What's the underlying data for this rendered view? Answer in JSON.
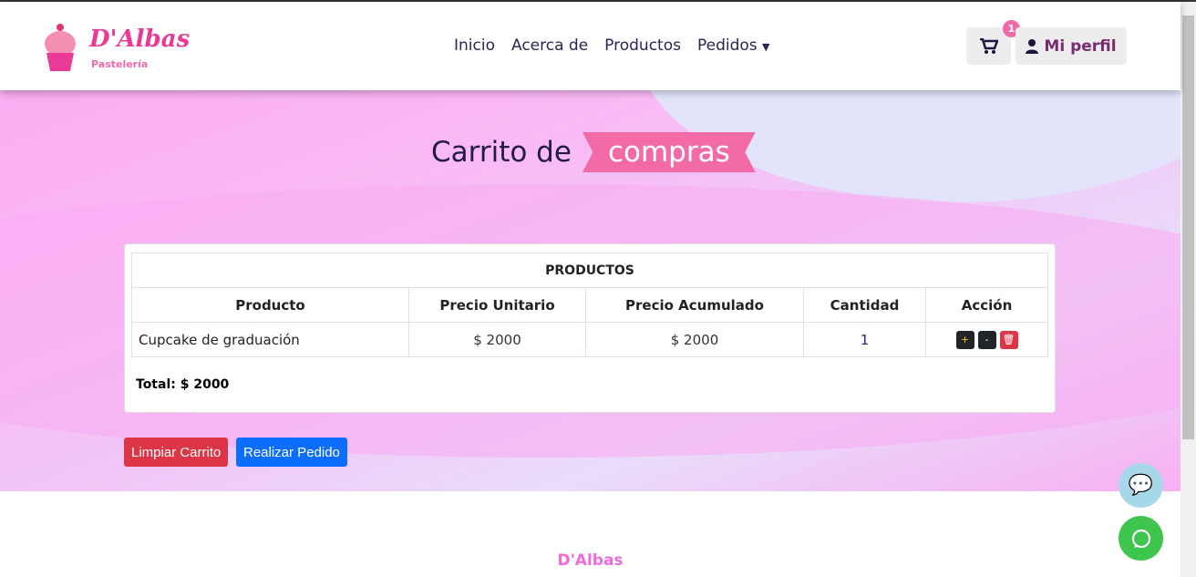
{
  "brand": {
    "name": "D'Albas",
    "tagline": "Pastelería"
  },
  "nav": {
    "items": [
      "Inicio",
      "Acerca de",
      "Productos",
      "Pedidos"
    ],
    "cart_count": "1",
    "profile": "Mi perfil"
  },
  "page": {
    "title": "Carrito de",
    "title_highlight": "compras"
  },
  "table": {
    "caption": "PRODUCTOS",
    "headers": [
      "Producto",
      "Precio Unitario",
      "Precio Acumulado",
      "Cantidad",
      "Acción"
    ],
    "rows": [
      {
        "product": "Cupcake de graduación",
        "unit": "$ 2000",
        "acc": "$ 2000",
        "qty": "1"
      }
    ],
    "total": "Total: $ 2000"
  },
  "actions": {
    "clear": "Limpiar Carrito",
    "order": "Realizar Pedido"
  },
  "footer": {
    "brand": "D'Albas"
  },
  "colors": {
    "accent": "#f26ba6",
    "danger": "#dc3545",
    "primary": "#0d6efd"
  }
}
